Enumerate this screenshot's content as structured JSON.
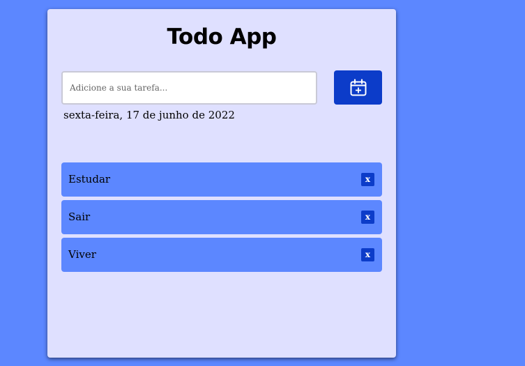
{
  "app": {
    "title": "Todo App"
  },
  "form": {
    "input_value": "",
    "input_placeholder": "Adicione a sua tarefa...",
    "add_button_icon": "calendar-plus-icon"
  },
  "date_text": "sexta-feira, 17 de junho de 2022",
  "tasks": [
    {
      "label": "Estudar",
      "delete_label": "x"
    },
    {
      "label": "Sair",
      "delete_label": "x"
    },
    {
      "label": "Viver",
      "delete_label": "x"
    }
  ],
  "colors": {
    "background": "#5c87ff",
    "card": "#dfe0ff",
    "accent": "#0c3cc9",
    "task_item": "#5c87ff"
  }
}
